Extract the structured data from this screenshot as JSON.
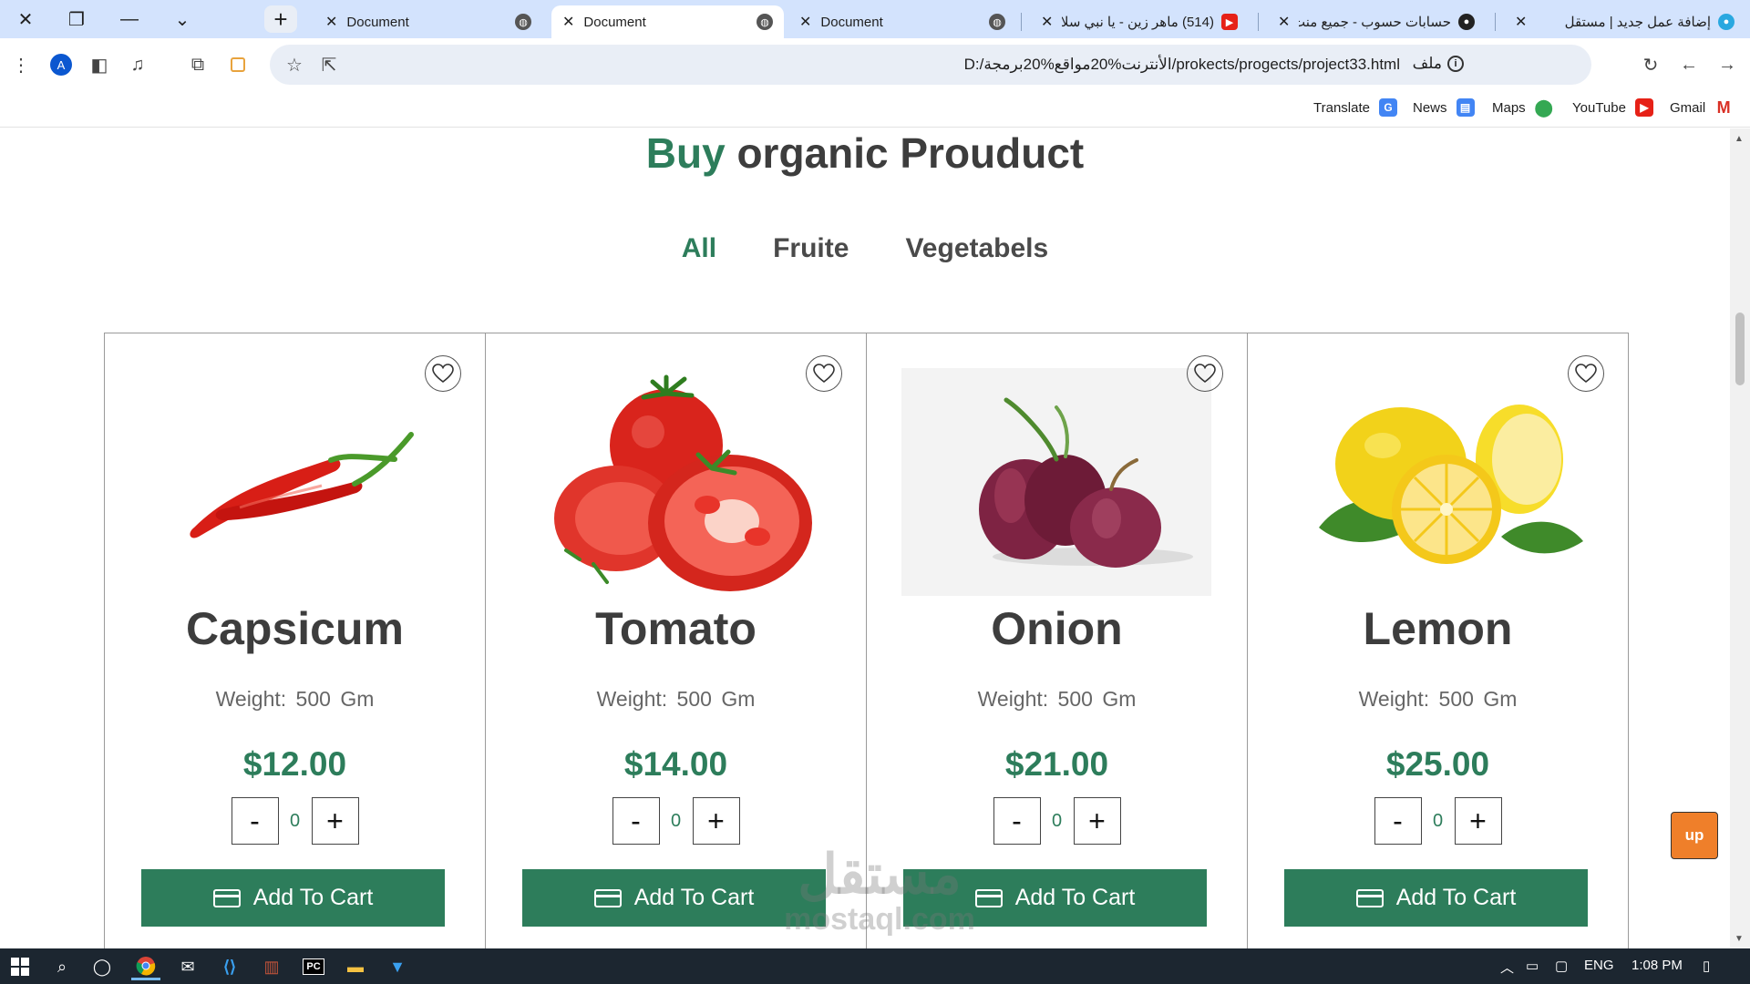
{
  "browser": {
    "tabs": [
      {
        "title": "Document",
        "active": false
      },
      {
        "title": "Document",
        "active": true
      },
      {
        "title": "Document",
        "active": false
      },
      {
        "title": "(514) ماهر زين - يا نبي سلا"
      },
      {
        "title": "حسابات حسوب - جميع منت"
      },
      {
        "title": "إضافة عمل جديد | مستقل"
      }
    ],
    "url": "D:/الأنترنت%20مواقع%20برمجة/prokects/progects/project33.html",
    "file_label": "ملف",
    "profile_initial": "A",
    "bookmarks": [
      "Gmail",
      "YouTube",
      "Maps",
      "News",
      "Translate"
    ]
  },
  "page": {
    "heading_accent": "Buy",
    "heading_rest": "organic Prouduct",
    "filters": [
      "All",
      "Fruite",
      "Vegetabels"
    ],
    "products": [
      {
        "name": "Capsicum",
        "weight": "Weight: 500 Gm",
        "price": "$12.00",
        "qty": "0",
        "image": "red-chili-peppers",
        "cart_label": "Add To Cart"
      },
      {
        "name": "Tomato",
        "weight": "Weight: 500 Gm",
        "price": "$14.00",
        "qty": "0",
        "image": "tomatoes",
        "cart_label": "Add To Cart"
      },
      {
        "name": "Onion",
        "weight": "Weight: 500 Gm",
        "price": "$21.00",
        "qty": "0",
        "image": "red-onions",
        "cart_label": "Add To Cart"
      },
      {
        "name": "Lemon",
        "weight": "Weight: 500 Gm",
        "price": "$25.00",
        "qty": "0",
        "image": "lemons",
        "cart_label": "Add To Cart"
      }
    ],
    "minus_label": "-",
    "plus_label": "+",
    "up_label": "up",
    "watermark_arabic": "مستقل",
    "watermark_latin": "mostaql.com"
  },
  "taskbar": {
    "language": "ENG",
    "time": "1:08 PM"
  },
  "colors": {
    "accent": "#2d7d5b",
    "up_button": "#ef7f2a",
    "tabbar": "#d3e3fd"
  }
}
